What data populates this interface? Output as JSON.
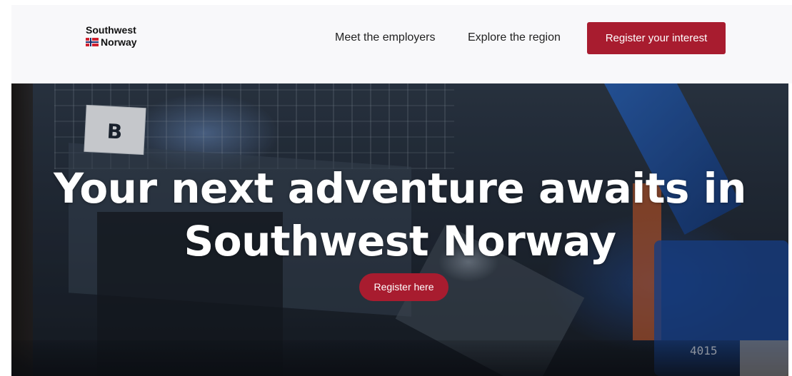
{
  "header": {
    "logo": {
      "line1": "Southwest",
      "line2": "Norway",
      "flag_icon": "norway-flag-icon"
    },
    "nav": {
      "employers_label": "Meet the employers",
      "region_label": "Explore the region"
    },
    "cta_label": "Register your interest"
  },
  "hero": {
    "sign_letter": "B",
    "machine_tag": "4015",
    "title_line1": "Your next adventure awaits in",
    "title_line2": "Southwest Norway",
    "button_label": "Register here"
  },
  "colors": {
    "accent": "#a81c2f",
    "header_bg": "#f8f8fa"
  }
}
